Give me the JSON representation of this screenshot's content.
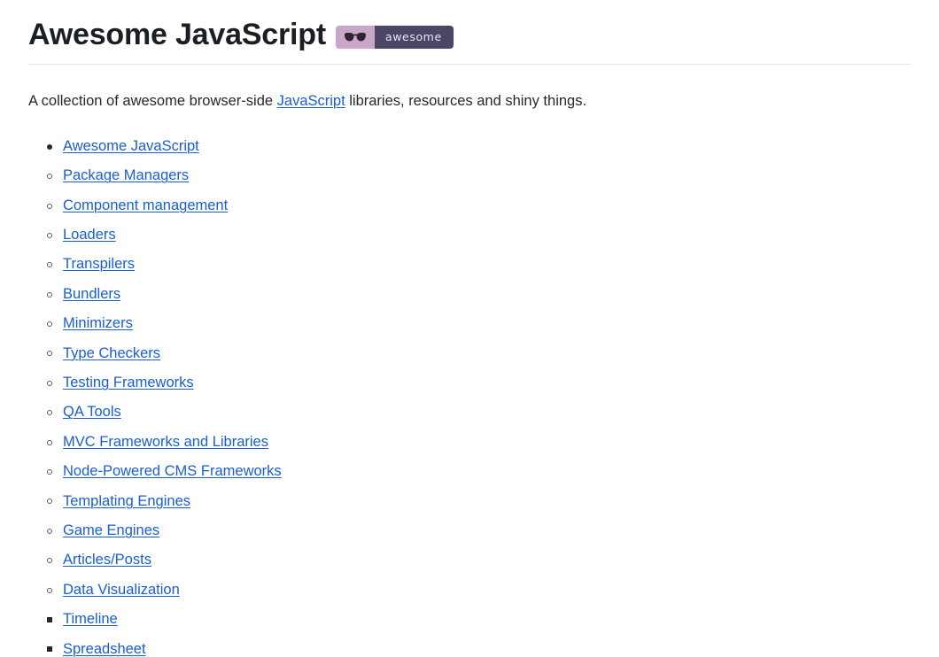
{
  "header": {
    "title": "Awesome JavaScript",
    "badge": {
      "icon": "sunglasses-icon",
      "label": "awesome",
      "left_color": "#c9a7c9",
      "right_color": "#4c4566",
      "text_color": "#e9e6ef"
    }
  },
  "intro": {
    "before_link": "A collection of awesome browser-side ",
    "link": "JavaScript",
    "after_link": " libraries, resources and shiny things."
  },
  "colors": {
    "link": "#1a5fcf",
    "text": "#24292e",
    "heading": "#1b1f23",
    "rule": "#e1e4e8",
    "background": "#ffffff"
  },
  "toc": {
    "root": "Awesome JavaScript",
    "items": [
      {
        "label": "Package Managers",
        "children": []
      },
      {
        "label": "Component management",
        "children": []
      },
      {
        "label": "Loaders",
        "children": []
      },
      {
        "label": "Transpilers",
        "children": []
      },
      {
        "label": "Bundlers",
        "children": []
      },
      {
        "label": "Minimizers",
        "children": []
      },
      {
        "label": "Type Checkers",
        "children": []
      },
      {
        "label": "Testing Frameworks",
        "children": []
      },
      {
        "label": "QA Tools",
        "children": []
      },
      {
        "label": "MVC Frameworks and Libraries",
        "children": []
      },
      {
        "label": "Node-Powered CMS Frameworks",
        "children": []
      },
      {
        "label": "Templating Engines",
        "children": []
      },
      {
        "label": "Game Engines",
        "children": []
      },
      {
        "label": "Articles/Posts",
        "children": []
      },
      {
        "label": "Data Visualization",
        "children": [
          "Timeline",
          "Spreadsheet"
        ]
      }
    ]
  }
}
